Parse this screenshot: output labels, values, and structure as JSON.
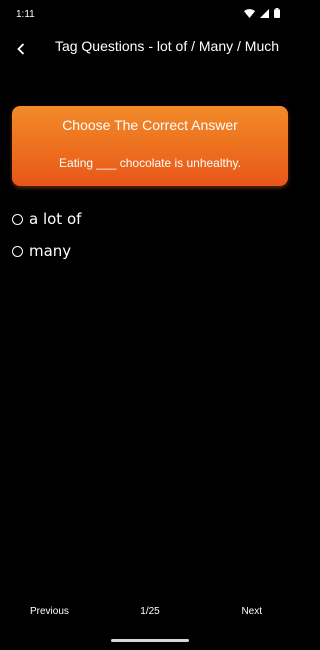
{
  "status_bar": {
    "time": "1:11",
    "icons": [
      "wifi-icon",
      "signal-icon",
      "battery-icon"
    ]
  },
  "header": {
    "title": "Tag Questions - lot of / Many / Much",
    "back_icon": "chevron-left-icon"
  },
  "question_card": {
    "heading": "Choose The Correct Answer",
    "question": "Eating ___ chocolate is unhealthy.",
    "accent_color": "#ee7420"
  },
  "options": [
    {
      "label": "a lot of",
      "selected": false
    },
    {
      "label": "many",
      "selected": false
    }
  ],
  "navigation": {
    "previous_label": "Previous",
    "page_indicator": "1/25",
    "next_label": "Next"
  },
  "colors": {
    "background": "#000000",
    "text": "#ffffff",
    "card_top": "#f28a2a",
    "card_bottom": "#e8561a"
  }
}
